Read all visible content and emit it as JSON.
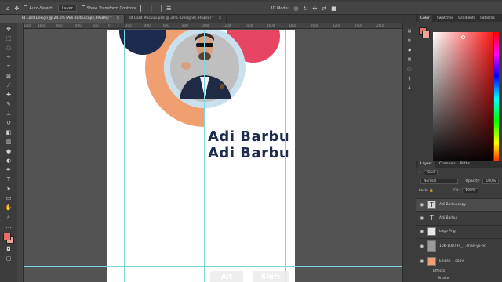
{
  "optionsbar": {
    "auto_select_label": "Auto-Select:",
    "auto_select_value": "Layer",
    "transform_label": "Show Transform Controls",
    "mode_3d": "3D Mode:"
  },
  "tabs": [
    {
      "label": "Id Card Design @ 24.6% (Adi Barbu copy, RGB/8) *",
      "close": "×"
    },
    {
      "label": "Id Card Mockup.psd @ 33% (Designer, RGB/8) *",
      "close": "×"
    }
  ],
  "ruler_ticks": [
    "1000",
    "1800",
    "600",
    "400",
    "200",
    "0",
    "200",
    "400",
    "600",
    "800",
    "1000",
    "1200",
    "1400",
    "1600",
    "1800",
    "2000",
    "2200",
    "2400",
    "2600"
  ],
  "canvas": {
    "name_line1": "Adi Barbu",
    "name_line2": "Adi Barbu",
    "key1": "Alt",
    "key_sep": "+",
    "key2": "Shift"
  },
  "colors": {
    "navy": "#1d2b4f",
    "orange": "#f0a070",
    "pink": "#e84563",
    "lightblue": "#c9e1ee",
    "guide": "#7fd6e3",
    "fg_swatch": "#e86d6d",
    "bg_swatch": "#e9a59a"
  },
  "color_panel": {
    "tabs": [
      "Color",
      "Swatches",
      "Gradients",
      "Patterns"
    ]
  },
  "layers_panel": {
    "tabs": [
      "Layers",
      "Channels",
      "Paths"
    ],
    "filter_label": "Kind",
    "blend_mode": "Normal",
    "opacity_label": "Opacity:",
    "opacity_value": "100%",
    "lock_label": "Lock:",
    "fill_label": "Fill:",
    "fill_value": "100%",
    "layers": [
      {
        "name": "Adi Barbu copy",
        "kind": "text",
        "selected": true
      },
      {
        "name": "Adi Barbu",
        "kind": "text",
        "selected": false
      },
      {
        "name": "Logo Png",
        "kind": "image",
        "selected": false
      },
      {
        "name": "106-108794_...-man-yo-hd",
        "kind": "image",
        "selected": false
      },
      {
        "name": "Ellipse 1 copy",
        "kind": "shape",
        "selected": false
      },
      {
        "name": "Effects",
        "kind": "effects",
        "selected": false
      },
      {
        "name": "Stroke",
        "kind": "effect",
        "selected": false
      }
    ]
  }
}
